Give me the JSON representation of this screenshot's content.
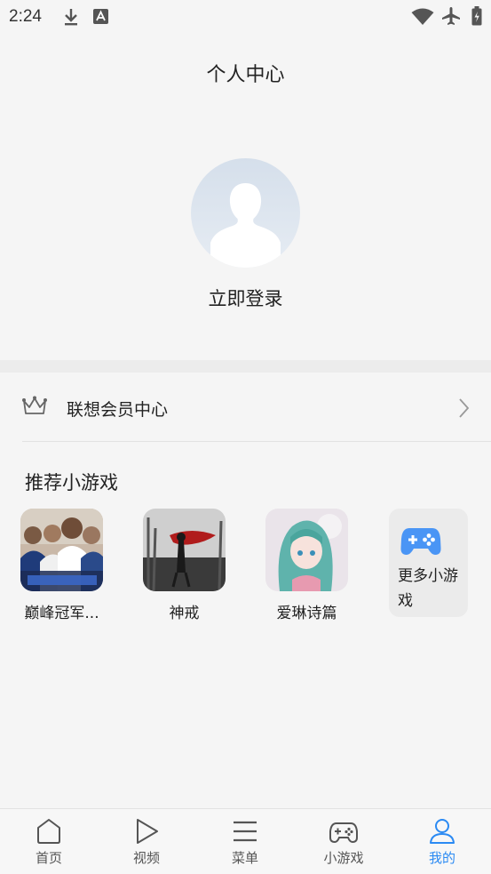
{
  "status_bar": {
    "time": "2:24"
  },
  "header": {
    "title": "个人中心"
  },
  "profile": {
    "login_label": "立即登录"
  },
  "member": {
    "label": "联想会员中心"
  },
  "games": {
    "section_title": "推荐小游戏",
    "items": [
      {
        "name": "巅峰冠军..."
      },
      {
        "name": "神戒"
      },
      {
        "name": "爱琳诗篇"
      }
    ],
    "more_label": "更多小游戏"
  },
  "bottom_nav": {
    "items": [
      {
        "label": "首页",
        "icon": "home-icon"
      },
      {
        "label": "视频",
        "icon": "play-icon"
      },
      {
        "label": "菜单",
        "icon": "menu-icon"
      },
      {
        "label": "小游戏",
        "icon": "gamepad-icon"
      },
      {
        "label": "我的",
        "icon": "user-icon"
      }
    ],
    "active_index": 4
  },
  "colors": {
    "accent": "#2b8af3",
    "background": "#f5f5f5",
    "avatar": "#d5dfeb"
  }
}
